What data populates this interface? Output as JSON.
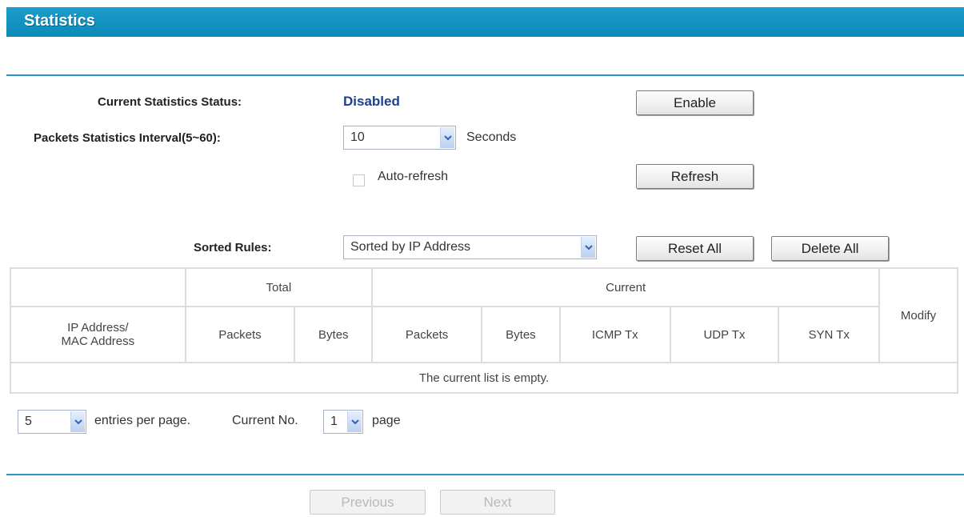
{
  "header": {
    "title": "Statistics"
  },
  "status": {
    "label": "Current Statistics Status:",
    "value": "Disabled",
    "enable_label": "Enable"
  },
  "interval": {
    "label": "Packets Statistics Interval(5~60):",
    "value": "10",
    "unit": "Seconds"
  },
  "autorefresh": {
    "label": "Auto-refresh",
    "checked": false
  },
  "refresh_label": "Refresh",
  "sorted": {
    "label": "Sorted Rules:",
    "value": "Sorted by IP Address",
    "reset_label": "Reset All",
    "delete_label": "Delete All"
  },
  "table": {
    "group_total": "Total",
    "group_current": "Current",
    "modify": "Modify",
    "ip_mac_line1": "IP Address/",
    "ip_mac_line2": "MAC Address",
    "cols": {
      "total_packets": "Packets",
      "total_bytes": "Bytes",
      "cur_packets": "Packets",
      "cur_bytes": "Bytes",
      "icmp": "ICMP Tx",
      "udp": "UDP Tx",
      "syn": "SYN Tx"
    },
    "empty": "The current list is empty."
  },
  "pagination": {
    "per_page_value": "5",
    "per_page_text": "entries per page.",
    "current_text": "Current No.",
    "current_value": "1",
    "page_text": "page",
    "previous_label": "Previous",
    "next_label": "Next"
  },
  "colors": {
    "title_bar": "#1b9cc9",
    "rule": "#2d93c6",
    "status_value": "#1f3f8f"
  }
}
